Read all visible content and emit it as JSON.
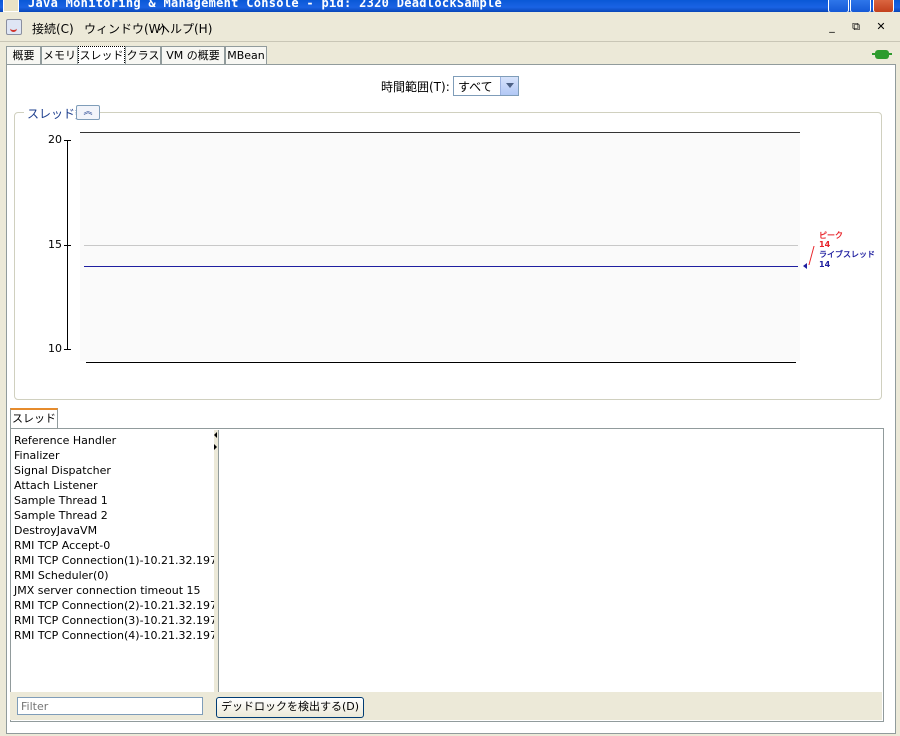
{
  "window": {
    "title": "Java Monitoring & Management Console - pid: 2320 DeadlockSample"
  },
  "menubar": {
    "items": [
      "接続(C)",
      "ウィンドウ(W)",
      "ヘルプ(H)"
    ],
    "minimize": "_",
    "restore": "⧉",
    "close": "✕"
  },
  "tabs": [
    {
      "label": "概要",
      "selected": false
    },
    {
      "label": "メモリ",
      "selected": false
    },
    {
      "label": "スレッド",
      "selected": true
    },
    {
      "label": "クラス",
      "selected": false
    },
    {
      "label": "VM の概要",
      "selected": false
    },
    {
      "label": "MBean",
      "selected": false
    }
  ],
  "time_range": {
    "label": "時間範囲(T):",
    "value": "すべて"
  },
  "chart_panel": {
    "title": "スレッド数",
    "collapse_icon": "double-chevron-up-icon"
  },
  "chart_data": {
    "type": "line",
    "ylim": [
      10,
      20
    ],
    "yticks": [
      20,
      15,
      10
    ],
    "series": [
      {
        "name": "ピーク",
        "value": 14,
        "color": "#e8242a",
        "values": [
          14
        ]
      },
      {
        "name": "ライブスレッド",
        "value": 14,
        "color": "#1f1fa0",
        "values": [
          14
        ]
      }
    ],
    "grid_line_values": [
      15
    ]
  },
  "threads_tab": {
    "label": "スレッド"
  },
  "threads": [
    "Reference Handler",
    "Finalizer",
    "Signal Dispatcher",
    "Attach Listener",
    "Sample Thread 1",
    "Sample Thread 2",
    "DestroyJavaVM",
    "RMI TCP Accept-0",
    "RMI TCP Connection(1)-10.21.32.197",
    "RMI Scheduler(0)",
    "JMX server connection timeout 15",
    "RMI TCP Connection(2)-10.21.32.197",
    "RMI TCP Connection(3)-10.21.32.197",
    "RMI TCP Connection(4)-10.21.32.197"
  ],
  "filter": {
    "placeholder": "Filter"
  },
  "detect_button": {
    "label": "デッドロックを検出する(D)"
  },
  "colors": {
    "titlebar": "#0a58d6",
    "peak": "#e8242a",
    "live": "#1f1fa0",
    "accent_tab": "#e68b2c"
  }
}
